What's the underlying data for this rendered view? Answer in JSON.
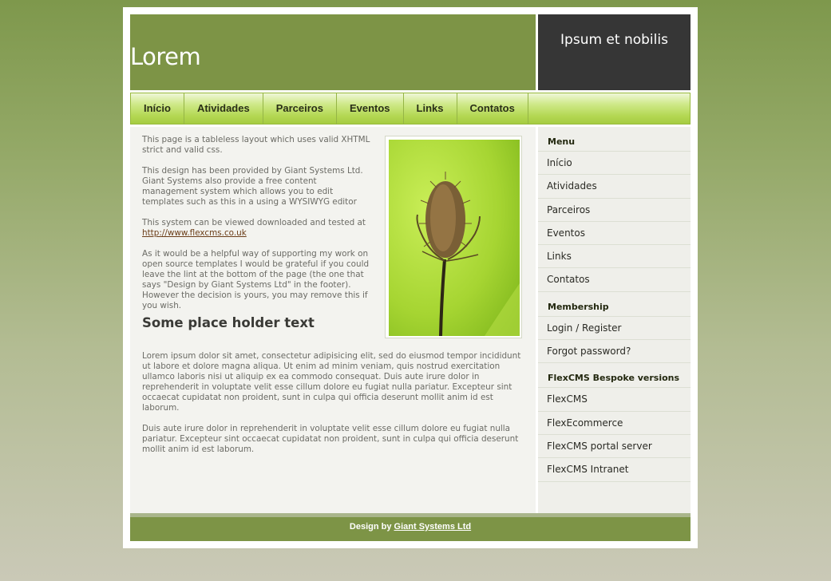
{
  "header": {
    "logo": "Lorem",
    "tagline": "Ipsum et nobilis"
  },
  "nav": [
    {
      "label": "Início"
    },
    {
      "label": "Atividades"
    },
    {
      "label": "Parceiros"
    },
    {
      "label": "Eventos"
    },
    {
      "label": "Links"
    },
    {
      "label": "Contatos"
    }
  ],
  "main": {
    "intro": [
      "This page is a tableless layout which uses valid XHTML strict and valid css.",
      "This design has been provided by Giant Systems Ltd. Giant Systems also provide a free content management system which allows you to edit templates such as this in a using a WYSIWYG editor",
      "As it would be a helpful way of supporting my work on open source templates I would be grateful if you could leave the lint at the bottom of the page (the one that says \"Design by Giant Systems Ltd\" in the footer). However the decision is yours, you may remove this if you wish."
    ],
    "download_text": "This system can be viewed downloaded and tested at",
    "download_link": "http://www.flexcms.co.uk",
    "heading": "Some place holder text",
    "body": [
      "Lorem ipsum dolor sit amet, consectetur adipisicing elit, sed do eiusmod tempor incididunt ut labore et dolore magna aliqua. Ut enim ad minim veniam, quis nostrud exercitation ullamco laboris nisi ut aliquip ex ea commodo consequat. Duis aute irure dolor in reprehenderit in voluptate velit esse cillum dolore eu fugiat nulla pariatur. Excepteur sint occaecat cupidatat non proident, sunt in culpa qui officia deserunt mollit anim id est laborum.",
      "Duis aute irure dolor in reprehenderit in voluptate velit esse cillum dolore eu fugiat nulla pariatur. Excepteur sint occaecat cupidatat non proident, sunt in culpa qui officia deserunt mollit anim id est laborum."
    ]
  },
  "sidebar": {
    "menu_heading": "Menu",
    "menu": [
      "Início",
      "Atividades",
      "Parceiros",
      "Eventos",
      "Links",
      "Contatos"
    ],
    "membership_heading": "Membership",
    "membership": [
      "Login / Register",
      "Forgot password?"
    ],
    "flexcms_heading": "FlexCMS Bespoke versions",
    "flexcms": [
      "FlexCMS",
      "FlexEcommerce",
      "FlexCMS portal server",
      "FlexCMS Intranet"
    ]
  },
  "footer": {
    "prefix": "Design by",
    "link": "Giant Systems Ltd"
  },
  "colors": {
    "header_green": "#7d9446",
    "header_dark": "#363636",
    "nav_light": "#cfe98a",
    "nav_dark": "#a6cc42",
    "link_brown": "#6b3d18"
  }
}
